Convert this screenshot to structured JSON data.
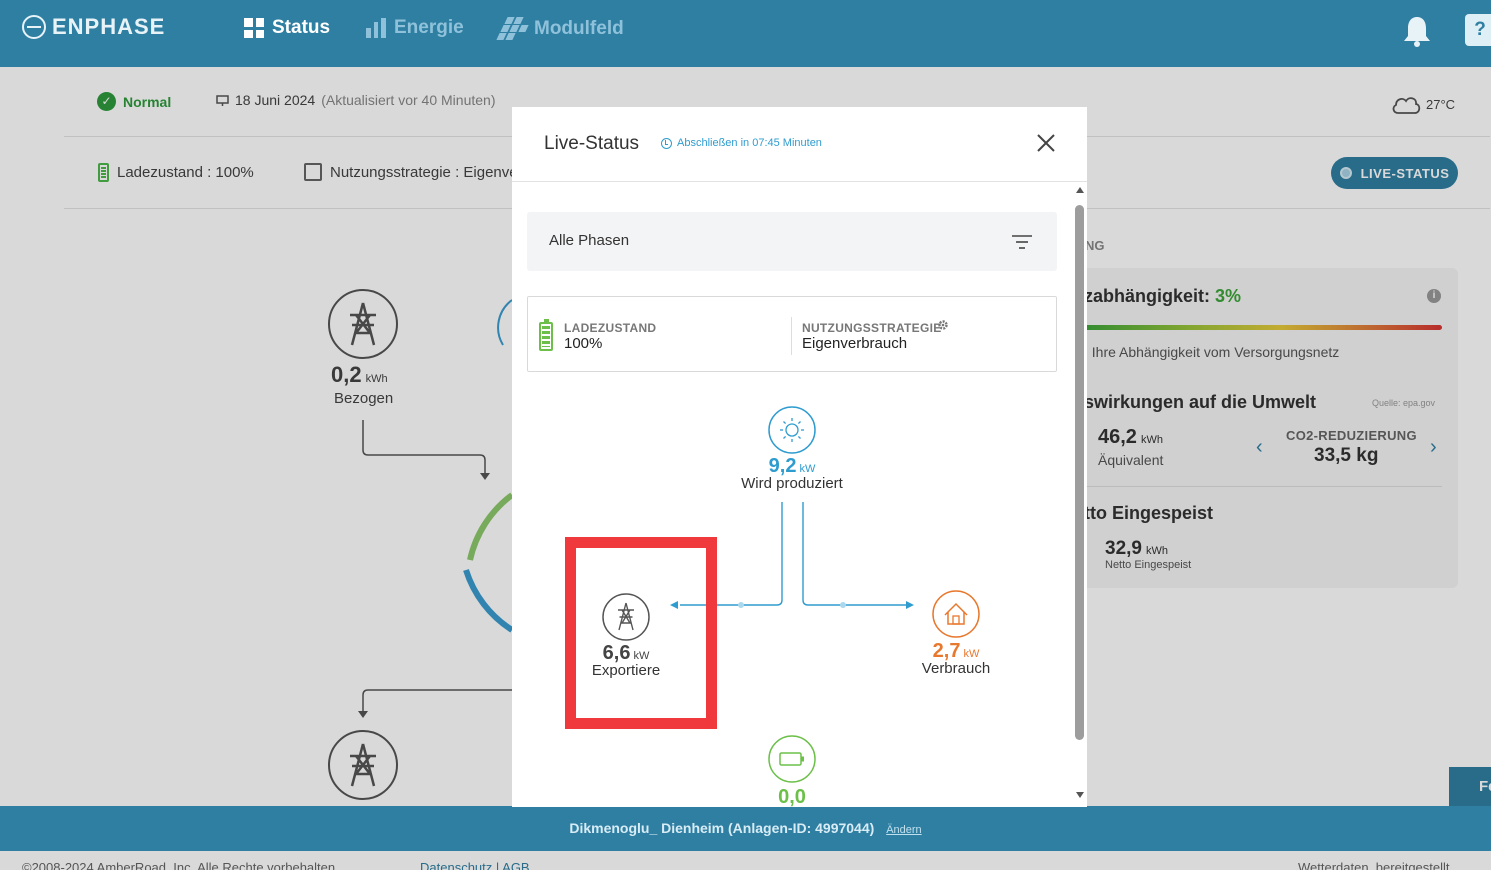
{
  "topbar": {
    "brand": "ENPHASE",
    "nav": [
      {
        "label": "Status",
        "icon": "grid-icon"
      },
      {
        "label": "Energie",
        "icon": "bar-chart-icon"
      },
      {
        "label": "Modulfeld",
        "icon": "modules-icon"
      }
    ],
    "help_label": "?"
  },
  "status_row": {
    "status": "Normal",
    "date": "18 Juni 2024",
    "updated": "(Aktualisiert vor 40 Minuten)",
    "weather": "27°C"
  },
  "summary_row": {
    "ladezustand": "Ladezustand : 100%",
    "nutzungsstrategie": "Nutzungsstrategie : Eigenverbrauch",
    "live_button": "LIVE-STATUS"
  },
  "background_flow": {
    "bezogen_value": "0,2",
    "bezogen_unit": "kWh",
    "bezogen_label": "Bezogen"
  },
  "right_panel": {
    "heading_partial": "NG",
    "netz_label": "zabhängigkeit:",
    "netz_value": "3%",
    "netz_sub": ": Ihre Abhängigkeit vom Versorgungsnetz",
    "umwelt_title": "swirkungen auf die Umwelt",
    "umwelt_source": "Quelle: epa.gov",
    "aequivalent_value": "46,2",
    "aequivalent_unit": "kWh",
    "aequivalent_label": "Äquivalent",
    "co2_label": "CO2-REDUZIERUNG",
    "co2_value": "33,5 kg",
    "netto_title": "tto Eingespeist",
    "netto_value": "32,9",
    "netto_unit": "kWh",
    "netto_label": "Netto Eingespeist",
    "fe_button": "Fe"
  },
  "footer": {
    "site": "Dikmenoglu_ Dienheim (Anlagen-ID: 4997044)",
    "change_link": "Ändern",
    "copyright": "©2008-2024 AmberRoad, Inc. Alle Rechte vorbehalten.",
    "links": "Datenschutz  |  AGB",
    "weather_credit": "Wetterdaten, bereitgestellt"
  },
  "modal": {
    "title": "Live-Status",
    "timer": "Abschließen in 07:45 Minuten",
    "phase": "Alle Phasen",
    "ladezustand_label": "LADEZUSTAND",
    "ladezustand_value": "100%",
    "strategie_label": "NUTZUNGSSTRATEGIE",
    "strategie_value": "Eigenverbrauch",
    "produced_value": "9,2",
    "produced_unit": "kW",
    "produced_label": "Wird produziert",
    "export_value": "6,6",
    "export_unit": "kW",
    "export_label": "Exportiere",
    "consumption_value": "2,7",
    "consumption_unit": "kW",
    "consumption_label": "Verbrauch",
    "battery_value": "0,0"
  },
  "colors": {
    "brand": "#2f7fa3",
    "solar": "#2f9ccf",
    "consumption": "#e8782e",
    "battery": "#6cc04a",
    "highlight": "#f0393d"
  }
}
